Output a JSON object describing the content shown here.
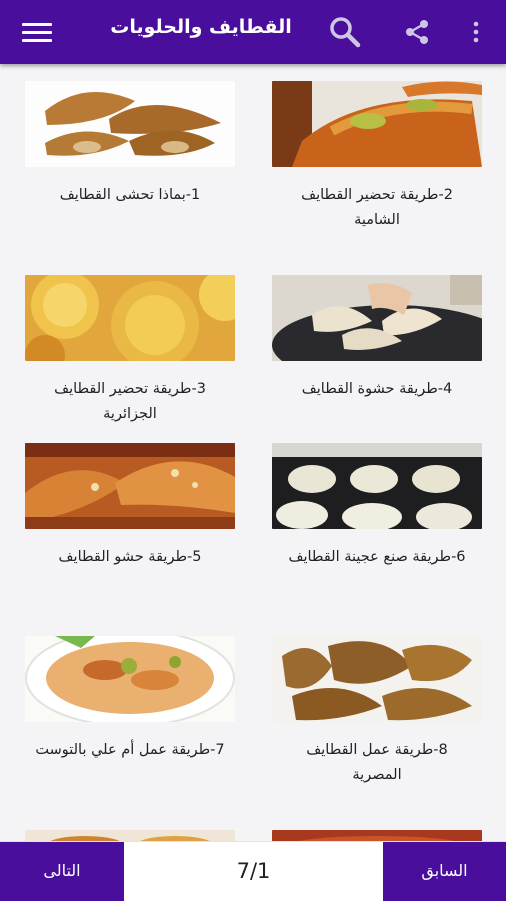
{
  "appbar": {
    "title": "القطايف والحلويات",
    "icons": [
      "menu-icon",
      "search-icon",
      "share-icon",
      "more-vertical-icon"
    ]
  },
  "articles": [
    {
      "title": "1-بماذا تحشى القطايف"
    },
    {
      "title": "2-طريقة تحضير القطايف الشامية"
    },
    {
      "title": "3-طريقة تحضير القطايف الجزائرية"
    },
    {
      "title": "4-طريقة حشوة القطايف"
    },
    {
      "title": "5-طريقة حشو القطايف"
    },
    {
      "title": "6-طريقة صنع عجينة القطايف"
    },
    {
      "title": "7-طريقة عمل أم علي بالتوست"
    },
    {
      "title": "8-طريقة عمل القطايف المصرية"
    }
  ],
  "pagination": {
    "previous_label": "السابق",
    "next_label": "التالى",
    "page_indicator": "7/1"
  },
  "colors": {
    "primary": "#4a0e9c",
    "background": "#f4f4f6"
  }
}
